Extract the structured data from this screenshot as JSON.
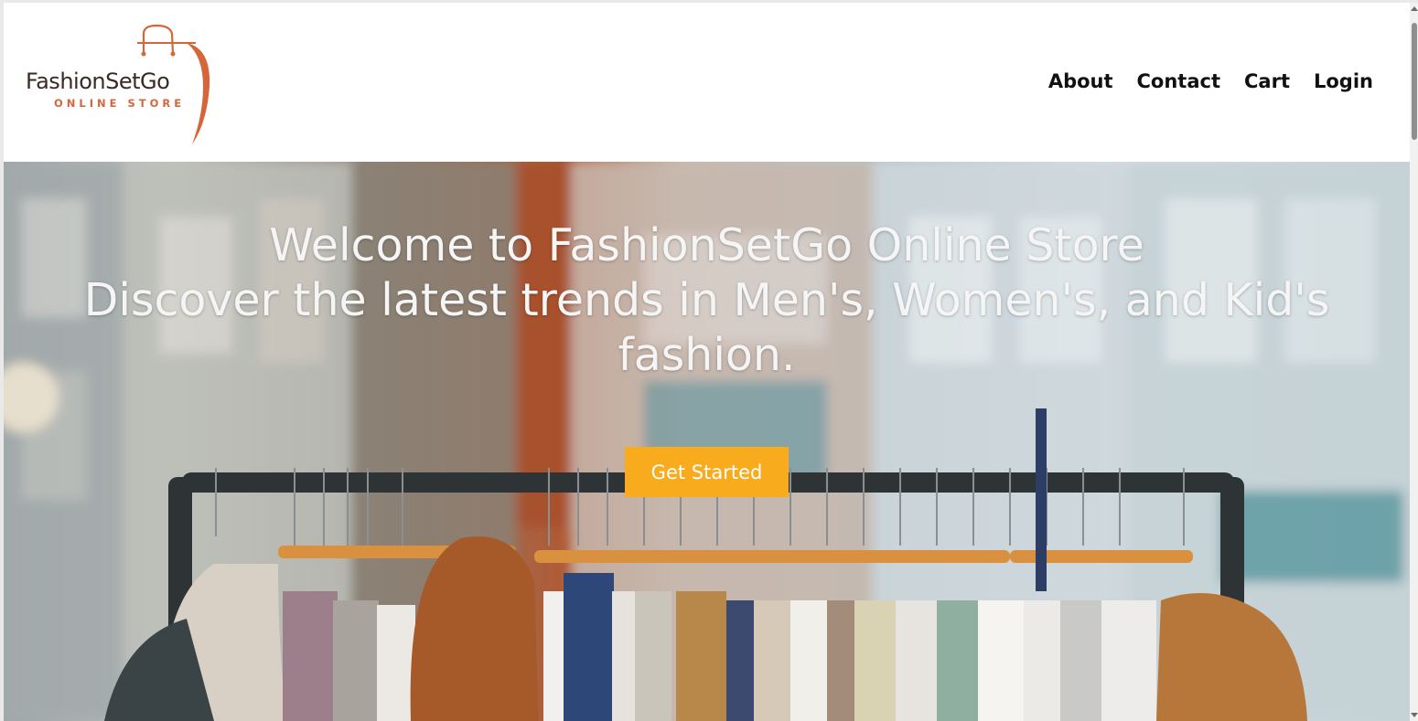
{
  "brand": {
    "name": "FashionSetGo",
    "tagline": "ONLINE STORE",
    "accent_color": "#d4663a",
    "logo_icon": "shopping-bag-icon"
  },
  "nav": {
    "items": [
      {
        "label": "About"
      },
      {
        "label": "Contact"
      },
      {
        "label": "Cart"
      },
      {
        "label": "Login"
      }
    ]
  },
  "hero": {
    "title": "Welcome to FashionSetGo Online Store",
    "subtitle": "Discover the latest trends in Men's, Women's, and Kid's fashion.",
    "cta_label": "Get Started",
    "cta_color": "#f9ab1e",
    "background_image": "clothing-rack-photo"
  }
}
